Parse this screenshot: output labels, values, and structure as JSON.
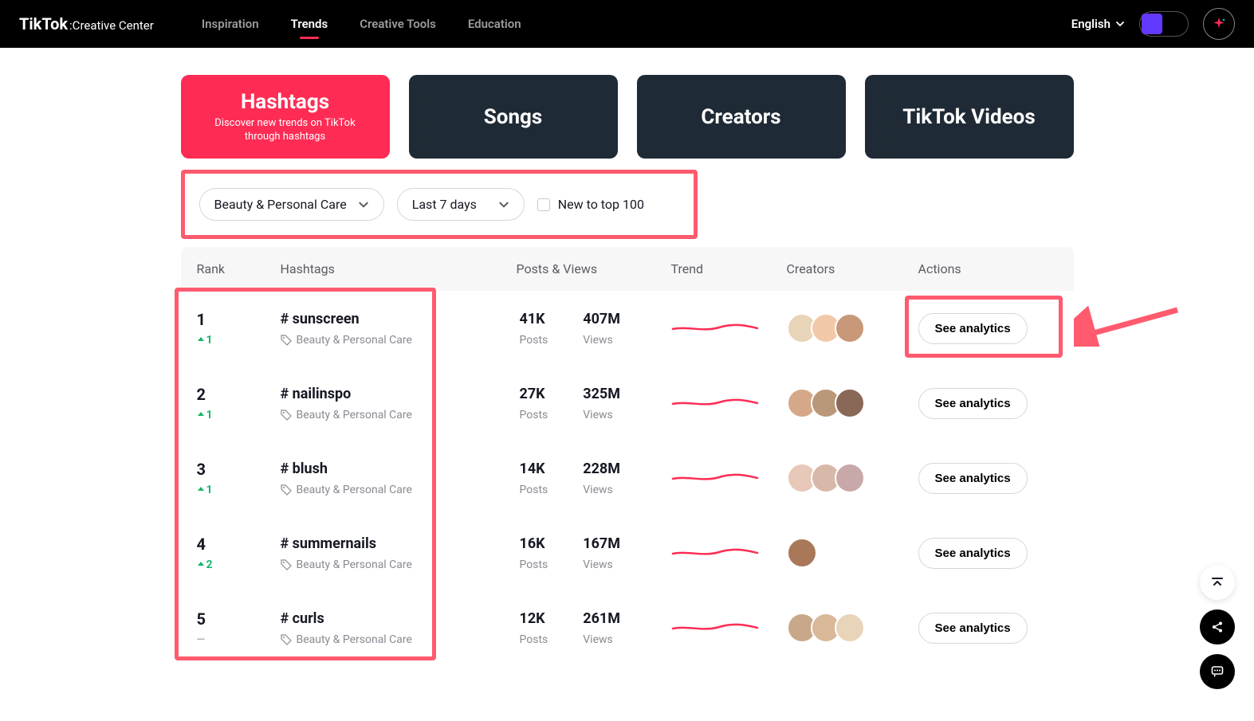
{
  "header": {
    "logo_main": "TikTok",
    "logo_sub": ":Creative Center",
    "nav": [
      {
        "label": "Inspiration",
        "active": false
      },
      {
        "label": "Trends",
        "active": true
      },
      {
        "label": "Creative Tools",
        "active": false
      },
      {
        "label": "Education",
        "active": false
      }
    ],
    "language": "English"
  },
  "tabs": [
    {
      "title": "Hashtags",
      "sub": "Discover new trends on TikTok through hashtags",
      "active": true
    },
    {
      "title": "Songs",
      "active": false
    },
    {
      "title": "Creators",
      "active": false
    },
    {
      "title": "TikTok Videos",
      "active": false
    }
  ],
  "filters": {
    "category": "Beauty & Personal Care",
    "period": "Last 7 days",
    "new_top_label": "New to top 100"
  },
  "columns": {
    "rank": "Rank",
    "hashtags": "Hashtags",
    "posts_views": "Posts & Views",
    "trend": "Trend",
    "creators": "Creators",
    "actions": "Actions"
  },
  "labels": {
    "posts": "Posts",
    "views": "Views",
    "see_analytics": "See analytics"
  },
  "rows": [
    {
      "rank": "1",
      "delta": "1",
      "delta_dir": "up",
      "name": "# sunscreen",
      "category": "Beauty & Personal Care",
      "posts": "41K",
      "views": "407M",
      "creators": 3
    },
    {
      "rank": "2",
      "delta": "1",
      "delta_dir": "up",
      "name": "# nailinspo",
      "category": "Beauty & Personal Care",
      "posts": "27K",
      "views": "325M",
      "creators": 3
    },
    {
      "rank": "3",
      "delta": "1",
      "delta_dir": "up",
      "name": "# blush",
      "category": "Beauty & Personal Care",
      "posts": "14K",
      "views": "228M",
      "creators": 3
    },
    {
      "rank": "4",
      "delta": "2",
      "delta_dir": "up",
      "name": "# summernails",
      "category": "Beauty & Personal Care",
      "posts": "16K",
      "views": "167M",
      "creators": 1
    },
    {
      "rank": "5",
      "delta": "—",
      "delta_dir": "neutral",
      "name": "# curls",
      "category": "Beauty & Personal Care",
      "posts": "12K",
      "views": "261M",
      "creators": 3
    }
  ],
  "avatar_colors": [
    "#e8d4b8",
    "#f2c8a8",
    "#c89878",
    "#d4a888",
    "#b89878",
    "#8a6858",
    "#e8c8b8",
    "#d8b8a8",
    "#c8a8a8",
    "#a87858",
    "#c8a888",
    "#d8b898"
  ]
}
